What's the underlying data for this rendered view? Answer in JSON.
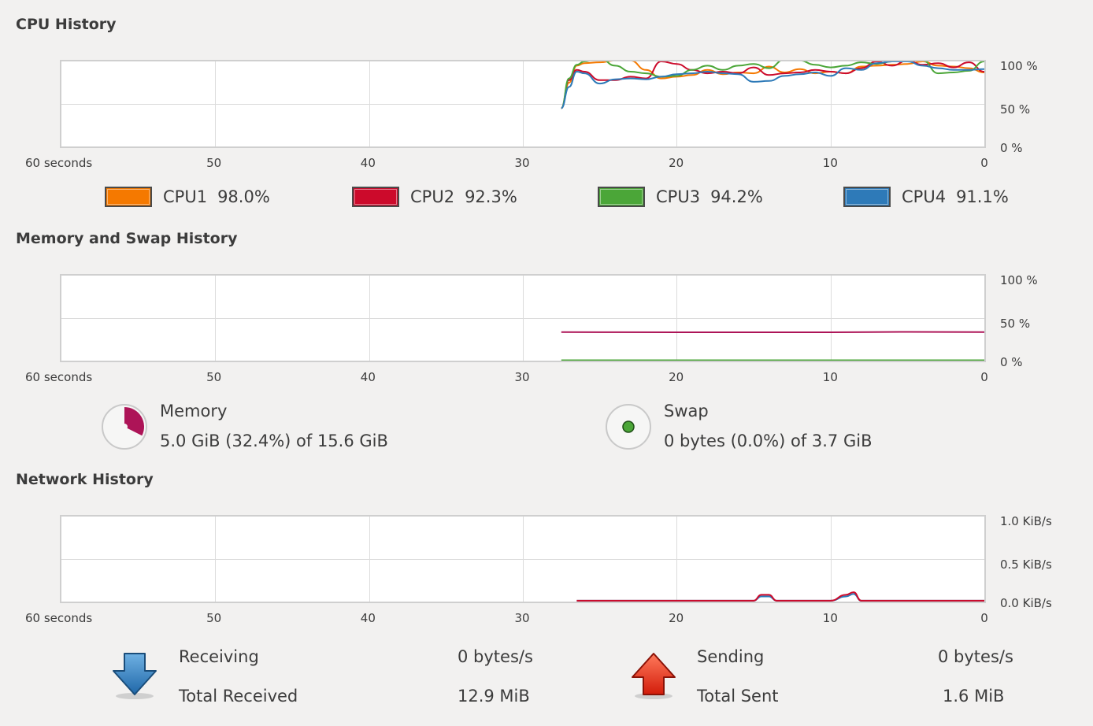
{
  "cpu": {
    "title": "CPU History",
    "x_ticks": [
      "60 seconds",
      "50",
      "40",
      "30",
      "20",
      "10",
      "0"
    ],
    "y_ticks": [
      "100 %",
      "50 %",
      "0 %"
    ],
    "legend": [
      {
        "name": "CPU1",
        "value": "98.0%",
        "color": "#f57900"
      },
      {
        "name": "CPU2",
        "value": "92.3%",
        "color": "#cc0a2b"
      },
      {
        "name": "CPU3",
        "value": "94.2%",
        "color": "#4ba638"
      },
      {
        "name": "CPU4",
        "value": "91.1%",
        "color": "#2e7ab8"
      }
    ]
  },
  "memory": {
    "title": "Memory and Swap History",
    "x_ticks": [
      "60 seconds",
      "50",
      "40",
      "30",
      "20",
      "10",
      "0"
    ],
    "y_ticks": [
      "100 %",
      "50 %",
      "0 %"
    ],
    "memory_label": "Memory",
    "memory_value": "5.0 GiB (32.4%) of 15.6 GiB",
    "memory_color": "#ad1457",
    "memory_fraction": 0.324,
    "swap_label": "Swap",
    "swap_value": "0 bytes (0.0%) of 3.7 GiB",
    "swap_color": "#4ba638",
    "swap_fraction": 0.0
  },
  "network": {
    "title": "Network History",
    "x_ticks": [
      "60 seconds",
      "50",
      "40",
      "30",
      "20",
      "10",
      "0"
    ],
    "y_ticks": [
      "1.0 KiB/s",
      "0.5 KiB/s",
      "0.0 KiB/s"
    ],
    "receiving_label": "Receiving",
    "receiving_value": "0 bytes/s",
    "total_received_label": "Total Received",
    "total_received_value": "12.9 MiB",
    "sending_label": "Sending",
    "sending_value": "0 bytes/s",
    "total_sent_label": "Total Sent",
    "total_sent_value": "1.6 MiB",
    "receiving_color": "#2e7ab8",
    "sending_color": "#cc0a2b"
  },
  "chart_data": [
    {
      "type": "line",
      "title": "CPU History",
      "xlabel": "",
      "ylabel": "",
      "x": [
        27.5,
        27,
        26.5,
        26,
        25,
        24,
        23,
        22,
        21,
        20,
        19,
        18,
        17,
        16,
        15,
        14,
        13,
        12,
        11,
        10,
        9,
        8,
        7,
        6,
        5,
        4,
        3,
        2,
        1,
        0
      ],
      "xlim": [
        60,
        0
      ],
      "ylim": [
        0,
        100
      ],
      "series": [
        {
          "name": "CPU1",
          "values": [
            45,
            75,
            95,
            98,
            99,
            101,
            101,
            90,
            80,
            82,
            84,
            90,
            85,
            87,
            86,
            94,
            87,
            91,
            86,
            88,
            86,
            94,
            95,
            96,
            97,
            100,
            95,
            94,
            92,
            87
          ]
        },
        {
          "name": "CPU2",
          "values": [
            45,
            78,
            90,
            88,
            78,
            78,
            82,
            80,
            100,
            97,
            90,
            86,
            88,
            86,
            93,
            84,
            86,
            87,
            90,
            88,
            86,
            92,
            100,
            95,
            101,
            96,
            98,
            93,
            99,
            88
          ]
        },
        {
          "name": "CPU3",
          "values": [
            45,
            80,
            96,
            100,
            104,
            95,
            88,
            86,
            82,
            83,
            90,
            95,
            90,
            95,
            97,
            92,
            102,
            101,
            96,
            93,
            95,
            99,
            97,
            100,
            101,
            101,
            86,
            87,
            89,
            100
          ]
        },
        {
          "name": "CPU4",
          "values": [
            45,
            70,
            88,
            86,
            74,
            79,
            80,
            79,
            82,
            85,
            86,
            88,
            86,
            85,
            76,
            77,
            83,
            85,
            87,
            83,
            92,
            90,
            98,
            100,
            100,
            95,
            92,
            90,
            90,
            91
          ]
        }
      ]
    },
    {
      "type": "line",
      "title": "Memory and Swap History",
      "x": [
        27.5,
        20,
        10,
        5,
        0
      ],
      "xlim": [
        60,
        0
      ],
      "ylim": [
        0,
        100
      ],
      "series": [
        {
          "name": "Memory",
          "values": [
            33.5,
            33.3,
            33.3,
            33.8,
            33.5
          ]
        },
        {
          "name": "Swap",
          "values": [
            0.5,
            0.5,
            0.5,
            0.5,
            0.5
          ]
        }
      ]
    },
    {
      "type": "line",
      "title": "Network History",
      "x": [
        26.5,
        15,
        14.5,
        14,
        13.5,
        10,
        9,
        8.5,
        8,
        7,
        0
      ],
      "xlim": [
        60,
        0
      ],
      "ylim": [
        0,
        1.0
      ],
      "series": [
        {
          "name": "Receiving",
          "values": [
            0.01,
            0.01,
            0.06,
            0.06,
            0.01,
            0.01,
            0.06,
            0.09,
            0.01,
            0.01,
            0.01
          ]
        },
        {
          "name": "Sending",
          "values": [
            0.01,
            0.01,
            0.08,
            0.08,
            0.01,
            0.01,
            0.08,
            0.11,
            0.01,
            0.01,
            0.01
          ]
        }
      ]
    }
  ]
}
